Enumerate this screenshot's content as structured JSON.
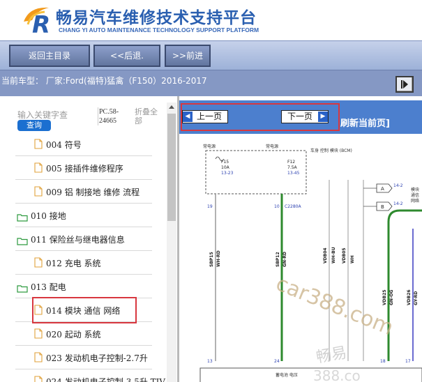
{
  "header": {
    "title_cn": "畅易汽车维修技术支持平台",
    "title_en": "CHANG YI AUTO MAINTENANCE TECHNOLOGY SUPPORT PLATFORM",
    "logo_letter": "R",
    "logo_icon": "changyi-r-logo-icon"
  },
  "nav": {
    "home": "返回主目录",
    "back": "<<后退.",
    "forward": ">>前进"
  },
  "car": {
    "info": "当前车型： 厂家:Ford(福特)猛禽（F150）2016-2017",
    "expand_icon": "expand-arrow-icon"
  },
  "search": {
    "placeholder": "输入关键字查",
    "button": "查询",
    "code": "PC.58-24665",
    "collapse_all": "折叠全部"
  },
  "tree": [
    {
      "type": "doc",
      "label": "004 符号"
    },
    {
      "type": "doc",
      "label": "005 接插件维修程序"
    },
    {
      "type": "doc",
      "label": "009 铝 制接地 维修 流程"
    },
    {
      "type": "folder",
      "label": "010 接地"
    },
    {
      "type": "folder",
      "label": "011 保险丝与继电器信息"
    },
    {
      "type": "doc",
      "label": "012 充电 系统"
    },
    {
      "type": "folder",
      "label": "013 配电"
    },
    {
      "type": "doc",
      "label": "014 模块 通信 网络",
      "selected": true
    },
    {
      "type": "doc",
      "label": "020 起动 系统"
    },
    {
      "type": "doc",
      "label": "023 发动机电子控制-2.7升"
    },
    {
      "type": "doc",
      "label": "024 发动机电子控制-3.5升 TIV"
    }
  ],
  "viewer": {
    "prev": "上一页",
    "next": "下一页",
    "refresh": "刷新当前页]"
  },
  "diagram": {
    "labels": {
      "hot1": "常电源",
      "hot2": "常电源",
      "bcm": "车身 控制 模块 (BCM)",
      "f15": "F15",
      "f15_amp": "10A",
      "f15_code": "13-23",
      "f12": "F12",
      "f12_amp": "7.5A",
      "f12_code": "13-45",
      "pin19": "19",
      "pin10": "10",
      "c2280": "C2280A",
      "con_a": "A",
      "con_b": "B",
      "ref1": "14-2",
      "ref2": "14-2",
      "side1": "模块",
      "side2": "通信",
      "side3": "网络",
      "w1": "SBP15",
      "w1c": "WH-RD",
      "w2": "SBP12",
      "w2c": "GN-RD",
      "w3": "VDB04",
      "w3c": "WH-BU",
      "w4": "VDB05",
      "w4c": "WH",
      "w5": "VDB25",
      "w5c": "GN-OG",
      "w6": "VDB26",
      "w6c": "GY-RD",
      "pin13": "13",
      "pin24": "24",
      "pin18": "18",
      "pin17": "17",
      "bottom": "蓄电池 电压",
      "wm1": "car388.com",
      "wm2": "畅易",
      "wm3": "388.co"
    }
  }
}
